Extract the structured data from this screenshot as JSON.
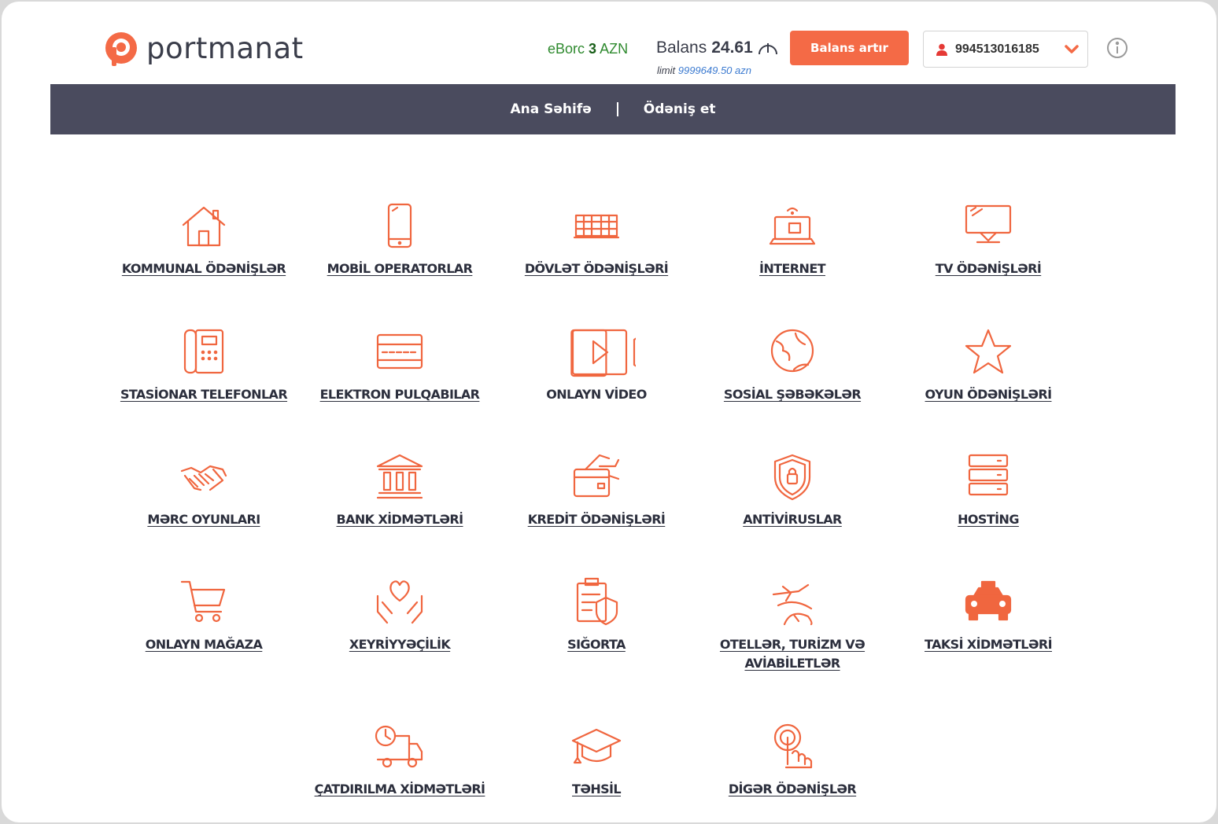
{
  "brand": {
    "name": "portmanat",
    "color": "#f46a46"
  },
  "header": {
    "eborc_prefix": "eBorc",
    "eborc_amount": "3",
    "eborc_currency": "AZN",
    "balance_label": "Balans",
    "balance_value": "24.61",
    "limit_label": "limit",
    "limit_value": "9999649.50 azn",
    "topup_button": "Balans artır",
    "account_phone": "994513016185"
  },
  "nav": {
    "items": [
      "Ana Səhifə",
      "Ödəniş et"
    ]
  },
  "categories": [
    {
      "label": "KOMMUNAL ÖDƏNİŞLƏR",
      "icon": "house-icon"
    },
    {
      "label": "MOBİL OPERATORLAR",
      "icon": "mobile-phone-icon"
    },
    {
      "label": "DÖVLƏT ÖDƏNİŞLƏRİ",
      "icon": "government-building-icon"
    },
    {
      "label": "İNTERNET",
      "icon": "laptop-wifi-icon"
    },
    {
      "label": "TV ÖDƏNİŞLƏRİ",
      "icon": "tv-icon"
    },
    {
      "label": "STASİONAR TELEFONLAR",
      "icon": "desk-phone-icon"
    },
    {
      "label": "ELEKTRON PULQABILAR",
      "icon": "card-wallet-icon"
    },
    {
      "label": "ONLAYN VİDEO",
      "icon": "video-camera-icon"
    },
    {
      "label": "SOSİAL ŞƏBƏKƏLƏR",
      "icon": "globe-icon"
    },
    {
      "label": "OYUN ÖDƏNİŞLƏRİ",
      "icon": "star-icon"
    },
    {
      "label": "MƏRC OYUNLARI",
      "icon": "handshake-icon"
    },
    {
      "label": "BANK XİDMƏTLƏRİ",
      "icon": "bank-icon"
    },
    {
      "label": "KREDİT ÖDƏNİŞLƏRİ",
      "icon": "credit-card-hand-icon"
    },
    {
      "label": "ANTİVİRUSLAR",
      "icon": "shield-lock-icon"
    },
    {
      "label": "HOSTİNG",
      "icon": "server-icon"
    },
    {
      "label": "ONLAYN MAĞAZA",
      "icon": "shopping-cart-icon"
    },
    {
      "label": "XEYRİYYƏÇİLİK",
      "icon": "heart-hands-icon"
    },
    {
      "label": "SIĞORTA",
      "icon": "insurance-document-icon"
    },
    {
      "label": "OTELLƏR, TURİZM VƏ AVİABİLETLƏR",
      "icon": "plane-globe-icon"
    },
    {
      "label": "TAKSİ XİDMƏTLƏRİ",
      "icon": "taxi-icon"
    },
    {
      "label": "ÇATDIRILMA XİDMƏTLƏRİ",
      "icon": "delivery-truck-icon"
    },
    {
      "label": "TƏHSİL",
      "icon": "graduation-cap-icon"
    },
    {
      "label": "DİGƏR ÖDƏNİŞLƏR",
      "icon": "tap-finger-icon"
    }
  ]
}
